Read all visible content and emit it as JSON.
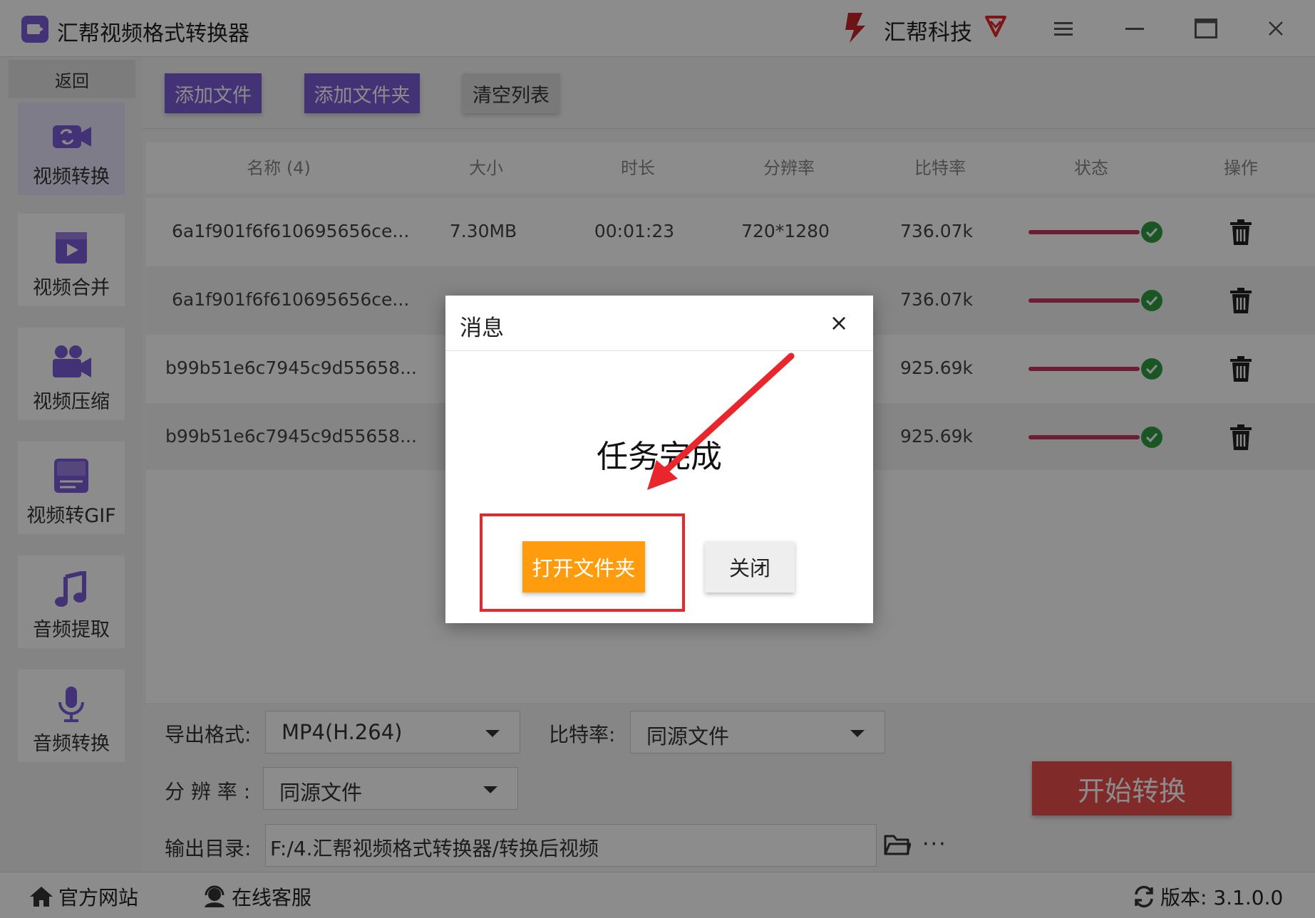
{
  "window": {
    "title": "汇帮视频格式转换器",
    "brand": "汇帮科技",
    "accent": "#7b5bd6"
  },
  "sidebar": {
    "back_label": "返回",
    "items": [
      {
        "label": "视频转换",
        "icon": "video-convert-icon",
        "active": true
      },
      {
        "label": "视频合并",
        "icon": "video-merge-icon"
      },
      {
        "label": "视频压缩",
        "icon": "video-compress-icon"
      },
      {
        "label": "视频转GIF",
        "icon": "gif-icon"
      },
      {
        "label": "音频提取",
        "icon": "music-note-icon"
      },
      {
        "label": "音频转换",
        "icon": "microphone-icon"
      }
    ]
  },
  "toolbar": {
    "add_file": "添加文件",
    "add_folder": "添加文件夹",
    "clear_list": "清空列表"
  },
  "table": {
    "columns": [
      "名称 (4)",
      "大小",
      "时长",
      "分辨率",
      "比特率",
      "状态",
      "操作"
    ],
    "rows": [
      {
        "name": "6a1f901f6f610695656ce...",
        "size": "7.30MB",
        "duration": "00:01:23",
        "resolution": "720*1280",
        "bitrate": "736.07k",
        "progress": 1.0
      },
      {
        "name": "6a1f901f6f610695656ce...",
        "size": "",
        "duration": "",
        "resolution": "",
        "bitrate": "736.07k",
        "progress": 1.0
      },
      {
        "name": "b99b51e6c7945c9d55658...",
        "size": "",
        "duration": "",
        "resolution": "",
        "bitrate": "925.69k",
        "progress": 1.0
      },
      {
        "name": "b99b51e6c7945c9d55658...",
        "size": "",
        "duration": "",
        "resolution": "",
        "bitrate": "925.69k",
        "progress": 1.0
      }
    ]
  },
  "settings": {
    "format_label": "导出格式:",
    "format_value": "MP4(H.264)",
    "bitrate_label": "比特率:",
    "bitrate_value": "同源文件",
    "resolution_label": "分 辨 率 :",
    "resolution_value": "同源文件",
    "output_label": "输出目录:",
    "output_value": "F:/4.汇帮视频格式转换器/转换后视频",
    "more": "···",
    "start": "开始转换"
  },
  "footer": {
    "website": "官方网站",
    "support": "在线客服",
    "version": "版本: 3.1.0.0"
  },
  "dialog": {
    "title": "消息",
    "close_x": "×",
    "message": "任务完成",
    "open_folder": "打开文件夹",
    "close": "关闭"
  },
  "colors": {
    "purple": "#7b5bd6",
    "orange": "#ff9c0d",
    "red": "#e94d4d",
    "progress": "#c8375f",
    "check": "#2e9d43",
    "annotation": "#e8262b"
  }
}
